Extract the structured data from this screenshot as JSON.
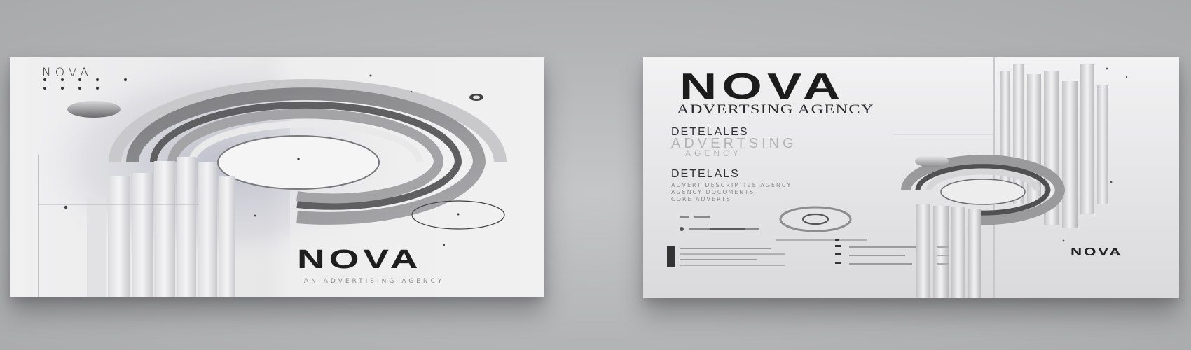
{
  "front_card": {
    "brand_small": "NOVA",
    "brand_large": "NOVA",
    "tagline": "AN ADVERTISING AGENCY"
  },
  "back_card": {
    "title": "NOVA",
    "subtitle": "ADVERTSING AGENCY",
    "section1_title": "DETELALES",
    "section1_ghost": "ADVERTSING",
    "section1_ghost2": "AGENCY",
    "section2_title": "DETELALS",
    "section2_lines": [
      "ADVERT DESCRIPTIVE AGENCY",
      "AGENCY DOCUMENTS",
      "CORE ADVERTS"
    ],
    "logo": "NOVA"
  },
  "colors": {
    "background": "#b1b2b4",
    "card_light": "#f0f0f1",
    "ink": "#1f1f1f"
  }
}
